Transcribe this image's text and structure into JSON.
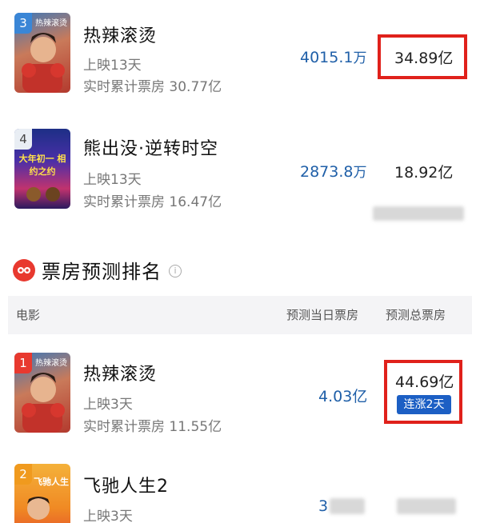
{
  "box_office_list": {
    "rows": [
      {
        "rank": "3",
        "poster_text": "热辣滚烫",
        "title": "热辣滚烫",
        "days": "上映13天",
        "total_label": "实时累计票房 30.77亿",
        "daily_value": "4015.1",
        "daily_unit": "万",
        "total_value": "34.89亿"
      },
      {
        "rank": "4",
        "poster_text": "大年初一 相约之约",
        "title": "熊出没·逆转时空",
        "days": "上映13天",
        "total_label": "实时累计票房 16.47亿",
        "daily_value": "2873.8",
        "daily_unit": "万",
        "total_value": "18.92亿"
      }
    ]
  },
  "forecast": {
    "section_title": "票房预测排名",
    "info_icon": "i",
    "headers": {
      "movie": "电影",
      "day_forecast": "预测当日票房",
      "total_forecast": "预测总票房"
    },
    "rows": [
      {
        "rank": "1",
        "poster_text": "热辣滚烫",
        "title": "热辣滚烫",
        "days": "上映3天",
        "total_label": "实时累计票房 11.55亿",
        "day_value": "4.03亿",
        "total_value": "44.69亿",
        "badge": "连涨2天"
      },
      {
        "rank": "2",
        "poster_text": "飞驰人生",
        "title": "飞驰人生2",
        "days": "上映3天",
        "day_value": "3"
      }
    ]
  },
  "colors": {
    "accent_red": "#e0211b",
    "value_blue": "#1f5fa8",
    "badge_blue": "#1c5fc4"
  }
}
